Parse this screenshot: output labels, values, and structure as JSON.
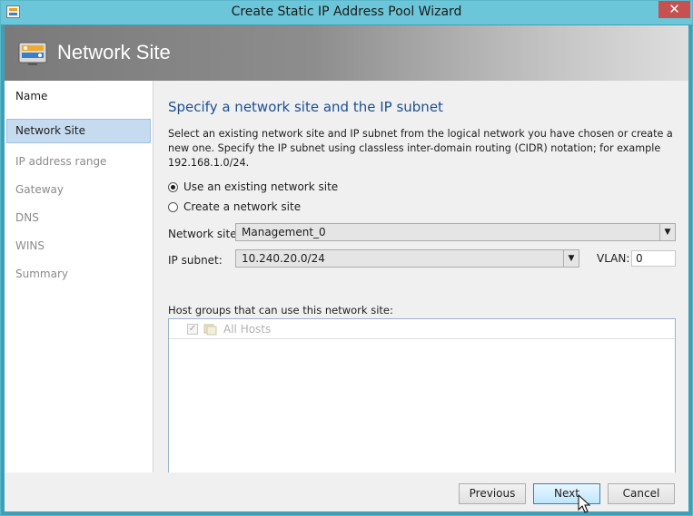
{
  "window": {
    "title": "Create Static IP Address Pool Wizard",
    "close_glyph": "✕",
    "accent_color": "#6cc6d9"
  },
  "banner": {
    "title": "Network Site",
    "icon": "network-site-icon"
  },
  "nav": {
    "items": [
      {
        "label": "Name",
        "state": "visited"
      },
      {
        "label": "Network Site",
        "state": "active"
      },
      {
        "label": "IP address range",
        "state": "pending"
      },
      {
        "label": "Gateway",
        "state": "pending"
      },
      {
        "label": "DNS",
        "state": "pending"
      },
      {
        "label": "WINS",
        "state": "pending"
      },
      {
        "label": "Summary",
        "state": "pending"
      }
    ]
  },
  "main": {
    "heading": "Specify a network site and the IP subnet",
    "description": "Select an existing network site and IP subnet from the logical network you have chosen or create a new one. Specify the IP subnet using classless inter-domain routing (CIDR) notation; for example 192.168.1.0/24.",
    "options": [
      {
        "label": "Use an existing network site",
        "checked": true
      },
      {
        "label": "Create a network site",
        "checked": false
      }
    ],
    "network_site_label": "Network site:",
    "network_site_value": "Management_0",
    "ip_subnet_label": "IP subnet:",
    "ip_subnet_value": "10.240.20.0/24",
    "vlan_label": "VLAN:",
    "vlan_value": "0",
    "host_groups_label": "Host groups that can use this network site:",
    "host_groups": [
      {
        "label": "All Hosts",
        "checked": true,
        "enabled": false
      }
    ]
  },
  "footer": {
    "previous_label": "Previous",
    "next_label": "Next",
    "cancel_label": "Cancel"
  }
}
